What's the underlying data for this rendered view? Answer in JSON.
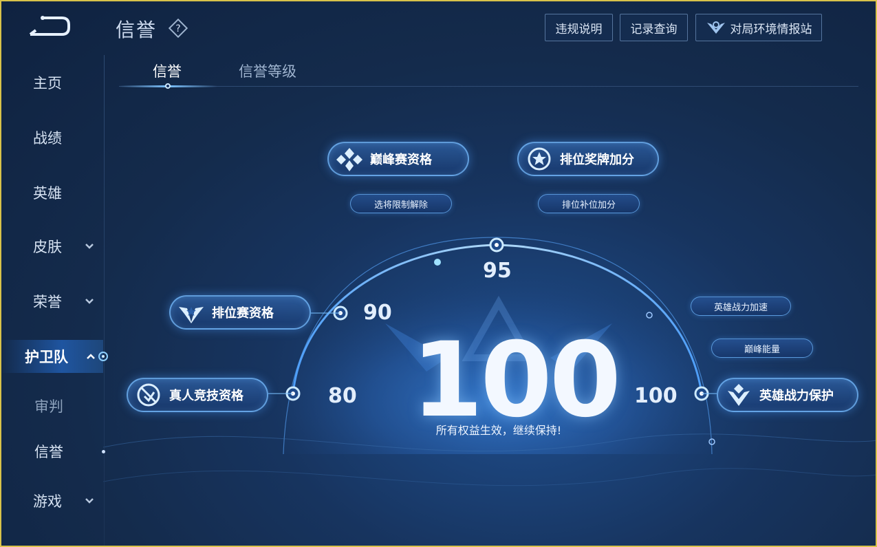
{
  "header": {
    "title": "信誉",
    "buttons": [
      "违规说明",
      "记录查询",
      "对局环境情报站"
    ]
  },
  "sidebar": {
    "items": [
      {
        "label": "主页"
      },
      {
        "label": "战绩"
      },
      {
        "label": "英雄"
      },
      {
        "label": "皮肤"
      },
      {
        "label": "荣誉"
      },
      {
        "label": "护卫队"
      },
      {
        "label": "审判"
      },
      {
        "label": "信誉"
      },
      {
        "label": "游戏"
      }
    ]
  },
  "tabs": [
    "信誉",
    "信誉等级"
  ],
  "benefits": {
    "peak_qualification": "巅峰赛资格",
    "peak_sub": "选将限制解除",
    "rank_medal_bonus": "排位奖牌加分",
    "rank_sub": "排位补位加分",
    "ranked_qualification": "排位赛资格",
    "real_player_qualification": "真人竞技资格",
    "hero_power_boost": "英雄战力加速",
    "peak_energy": "巅峰能量",
    "hero_power_protect": "英雄战力保护"
  },
  "thresholds": [
    "80",
    "90",
    "95",
    "100"
  ],
  "score": {
    "value": "100",
    "message": "所有权益生效，继续保持!"
  },
  "colors": {
    "accent": "#7dc3ff",
    "background": "#142b4c",
    "pill_border": "#78beff"
  }
}
